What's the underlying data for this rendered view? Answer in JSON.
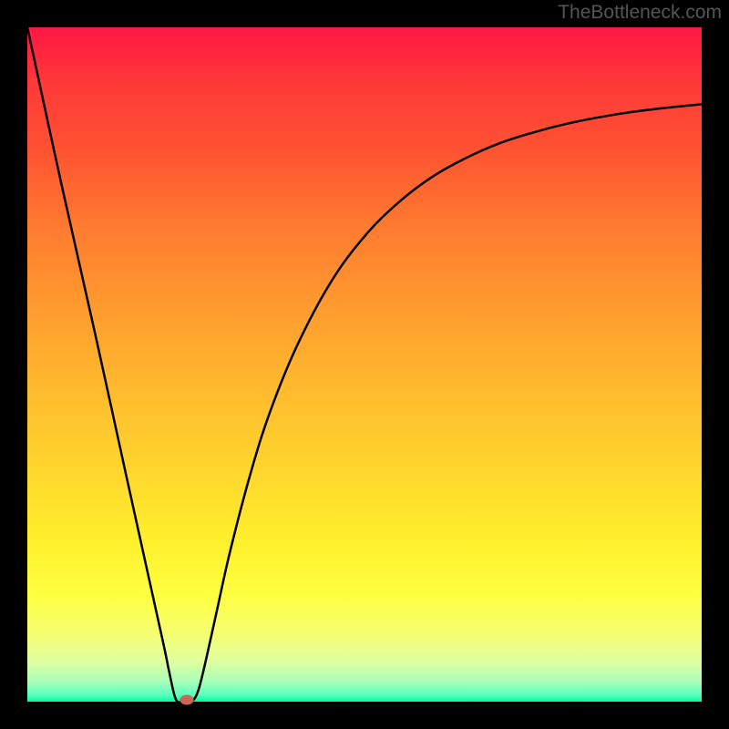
{
  "watermark": "TheBottleneck.com",
  "chart_data": {
    "type": "line",
    "title": "",
    "xlabel": "",
    "ylabel": "",
    "xlim": [
      0,
      100
    ],
    "ylim": [
      0,
      100
    ],
    "series": [
      {
        "name": "curve",
        "x": [
          0,
          5,
          10,
          15,
          20,
          21,
          22,
          23,
          24,
          25,
          26,
          28,
          30,
          33,
          36,
          40,
          45,
          50,
          55,
          60,
          65,
          70,
          75,
          80,
          85,
          90,
          95,
          100
        ],
        "values": [
          100,
          77,
          54.8,
          32,
          9.4,
          4.6,
          0.4,
          0,
          0,
          0.8,
          4.1,
          13,
          22,
          33.5,
          43,
          52.8,
          62.2,
          69,
          74,
          77.8,
          80.6,
          82.8,
          84.4,
          85.7,
          86.7,
          87.5,
          88.1,
          88.6
        ]
      }
    ],
    "marker": {
      "x": 23.6,
      "y": 0.3
    },
    "gradient_stops": [
      {
        "pos": 0,
        "color": "#ff1744"
      },
      {
        "pos": 50,
        "color": "#ffbb2e"
      },
      {
        "pos": 85,
        "color": "#feff3f"
      },
      {
        "pos": 100,
        "color": "#00ff99"
      }
    ]
  }
}
